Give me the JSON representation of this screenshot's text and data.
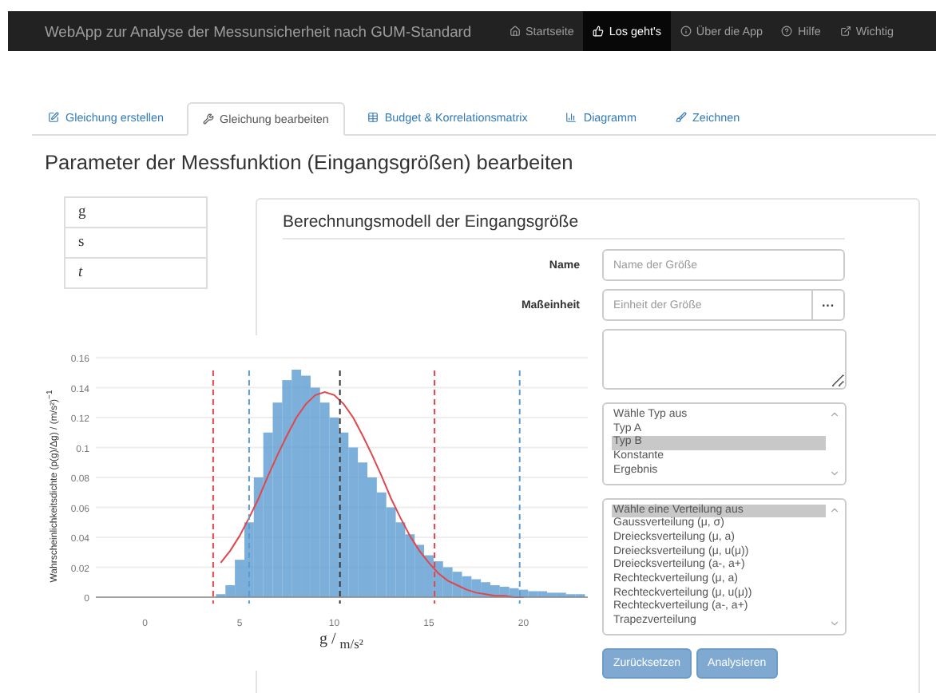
{
  "navbar": {
    "title": "WebApp zur Analyse der Messunsicherheit nach GUM-Standard",
    "items": [
      {
        "label": "Startseite",
        "selected": false
      },
      {
        "label": "Los geht's",
        "selected": true
      },
      {
        "label": "Über die App",
        "selected": false
      },
      {
        "label": "Hilfe",
        "selected": false
      },
      {
        "label": "Wichtig",
        "selected": false
      }
    ]
  },
  "tabs": [
    {
      "label": "Gleichung erstellen",
      "selected": false
    },
    {
      "label": "Gleichung bearbeiten",
      "selected": true
    },
    {
      "label": "Budget & Korrelationsmatrix",
      "selected": false
    },
    {
      "label": "Diagramm",
      "selected": false
    },
    {
      "label": "Zeichnen",
      "selected": false
    }
  ],
  "heading": "Parameter der Messfunktion (Eingangsgrößen) bearbeiten",
  "quantities": [
    {
      "label": "g",
      "italic": false
    },
    {
      "label": "s",
      "italic": false
    },
    {
      "label": "t",
      "italic": true
    }
  ],
  "chart": {
    "chart_data": {
      "type": "bar",
      "xlabel": "g / $_{m/s²}$",
      "ylabel": "Wahrscheinlichkeitsdichte (p(g)/Δg) / (m/s²)$^{−1}$",
      "grid": true,
      "xlim": [
        -2.6,
        23.4
      ],
      "ylim": [
        0,
        0.16
      ],
      "xticks": [
        0,
        5,
        10,
        15,
        20
      ],
      "yticks": [
        0,
        0.02,
        0.04,
        0.06,
        0.08,
        0.1,
        0.12,
        0.14,
        0.16
      ],
      "x": [
        4,
        4.5,
        5,
        5.5,
        6,
        6.5,
        7,
        7.5,
        8,
        8.5,
        9,
        9.5,
        10,
        10.5,
        11,
        11.5,
        12,
        12.5,
        13,
        13.5,
        14,
        14.5,
        15,
        15.5,
        16,
        16.5,
        17,
        17.5,
        18,
        18.5,
        19,
        19.5,
        20,
        20.5,
        21,
        21.5,
        22,
        22.5,
        23
      ],
      "series": [
        {
          "color": "#5b9bd1",
          "values": [
            0.002,
            0.008,
            0.025,
            0.05,
            0.08,
            0.11,
            0.13,
            0.145,
            0.152,
            0.148,
            0.14,
            0.13,
            0.12,
            0.11,
            0.1,
            0.09,
            0.08,
            0.07,
            0.06,
            0.05,
            0.042,
            0.035,
            0.028,
            0.024,
            0.02,
            0.017,
            0.014,
            0.012,
            0.01,
            0.008,
            0.007,
            0.006,
            0.005,
            0.004,
            0.004,
            0.003,
            0.003,
            0.002,
            0.002
          ]
        },
        {
          "type": "line",
          "color": "#e0474c",
          "values": [
            0.023,
            0.031,
            0.041,
            0.053,
            0.066,
            0.081,
            0.095,
            0.108,
            0.12,
            0.129,
            0.135,
            0.137,
            0.135,
            0.129,
            0.12,
            0.108,
            0.095,
            0.081,
            0.066,
            0.053,
            0.041,
            0.031,
            0.023,
            0.016,
            0.011,
            0.008,
            0.005,
            0.003,
            0.002,
            0.001,
            0.001,
            0,
            0,
            null,
            null,
            null,
            null,
            null,
            null
          ]
        }
      ],
      "ref_lines": [
        {
          "axis": "x",
          "value": 3.6,
          "color": "#e0474c"
        },
        {
          "axis": "x",
          "value": 15.3,
          "color": "#e0474c"
        },
        {
          "axis": "x",
          "value": 5.5,
          "color": "#5b9bd1"
        },
        {
          "axis": "x",
          "value": 19.8,
          "color": "#5b9bd1"
        },
        {
          "axis": "x",
          "value": 10.3,
          "color": "#333333"
        }
      ]
    }
  },
  "model_panel": {
    "title": "Berechnungsmodell der Eingangsgröße",
    "fields": [
      {
        "label": "Name",
        "placeholder": "Name der Größe"
      },
      {
        "label": "Maßeinheit",
        "placeholder": "Einheit der Größe",
        "button": "···"
      }
    ],
    "type_list": [
      {
        "label": "Wähle Typ aus",
        "selected": false
      },
      {
        "label": "Typ A",
        "selected": false
      },
      {
        "label": "Typ B",
        "selected": true
      },
      {
        "label": "Konstante",
        "selected": false
      },
      {
        "label": "Ergebnis",
        "selected": false
      }
    ],
    "distribution_list": [
      {
        "label": "Wähle eine Verteilung aus",
        "selected": true
      },
      {
        "label": "Gaussverteilung (μ, σ)",
        "selected": false
      },
      {
        "label": "Dreiecksverteilung (μ, a)",
        "selected": false
      },
      {
        "label": "Dreiecksverteilung (μ, u(μ))",
        "selected": false
      },
      {
        "label": "Dreiecksverteilung (a-, a+)",
        "selected": false
      },
      {
        "label": "Rechteckverteilung (μ, a)",
        "selected": false
      },
      {
        "label": "Rechteckverteilung (μ, u(μ))",
        "selected": false
      },
      {
        "label": "Rechteckverteilung (a-, a+)",
        "selected": false
      },
      {
        "label": "Trapezverteilung",
        "selected": false
      }
    ],
    "buttons": [
      "Zurücksetzen",
      "Analysieren"
    ]
  }
}
